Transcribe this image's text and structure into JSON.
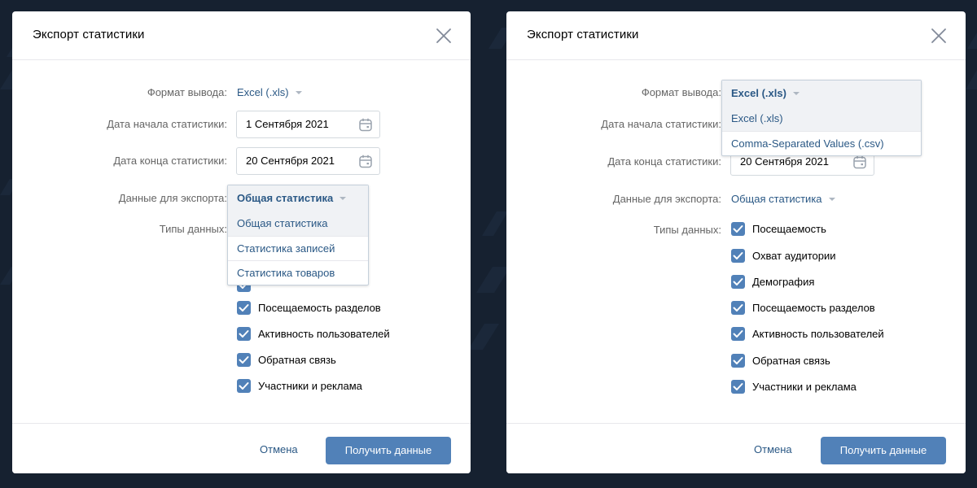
{
  "left": {
    "title": "Экспорт статистики",
    "format_label": "Формат вывода:",
    "format_value": "Excel (.xls)",
    "start_label": "Дата начала статистики:",
    "start_value": "1 Сентября 2021",
    "end_label": "Дата конца статистики:",
    "end_value": "20 Сентября 2021",
    "export_label": "Данные для экспорта:",
    "export_value": "Общая статистика",
    "types_label": "Типы данных:",
    "dropdown": [
      "Общая статистика",
      "Статистика записей",
      "Статистика товаров"
    ],
    "checkboxes": [
      "Посещаемость разделов",
      "Активность пользователей",
      "Обратная связь",
      "Участники и реклама"
    ],
    "cancel": "Отмена",
    "submit": "Получить данные"
  },
  "right": {
    "title": "Экспорт статистики",
    "format_label": "Формат вывода:",
    "format_value": "Excel (.xls)",
    "start_label": "Дата начала статистики:",
    "end_label": "Дата конца статистики:",
    "end_value": "20 Сентября 2021",
    "export_label": "Данные для экспорта:",
    "export_value": "Общая статистика",
    "types_label": "Типы данных:",
    "dropdown": [
      "Excel (.xls)",
      "Comma-Separated Values (.csv)"
    ],
    "checkboxes": [
      "Посещаемость",
      "Охват аудитории",
      "Демография",
      "Посещаемость разделов",
      "Активность пользователей",
      "Обратная связь",
      "Участники и реклама"
    ],
    "cancel": "Отмена",
    "submit": "Получить данные"
  },
  "colors": {
    "background": "#162130",
    "accent": "#5181b8",
    "link": "#2a5885"
  }
}
